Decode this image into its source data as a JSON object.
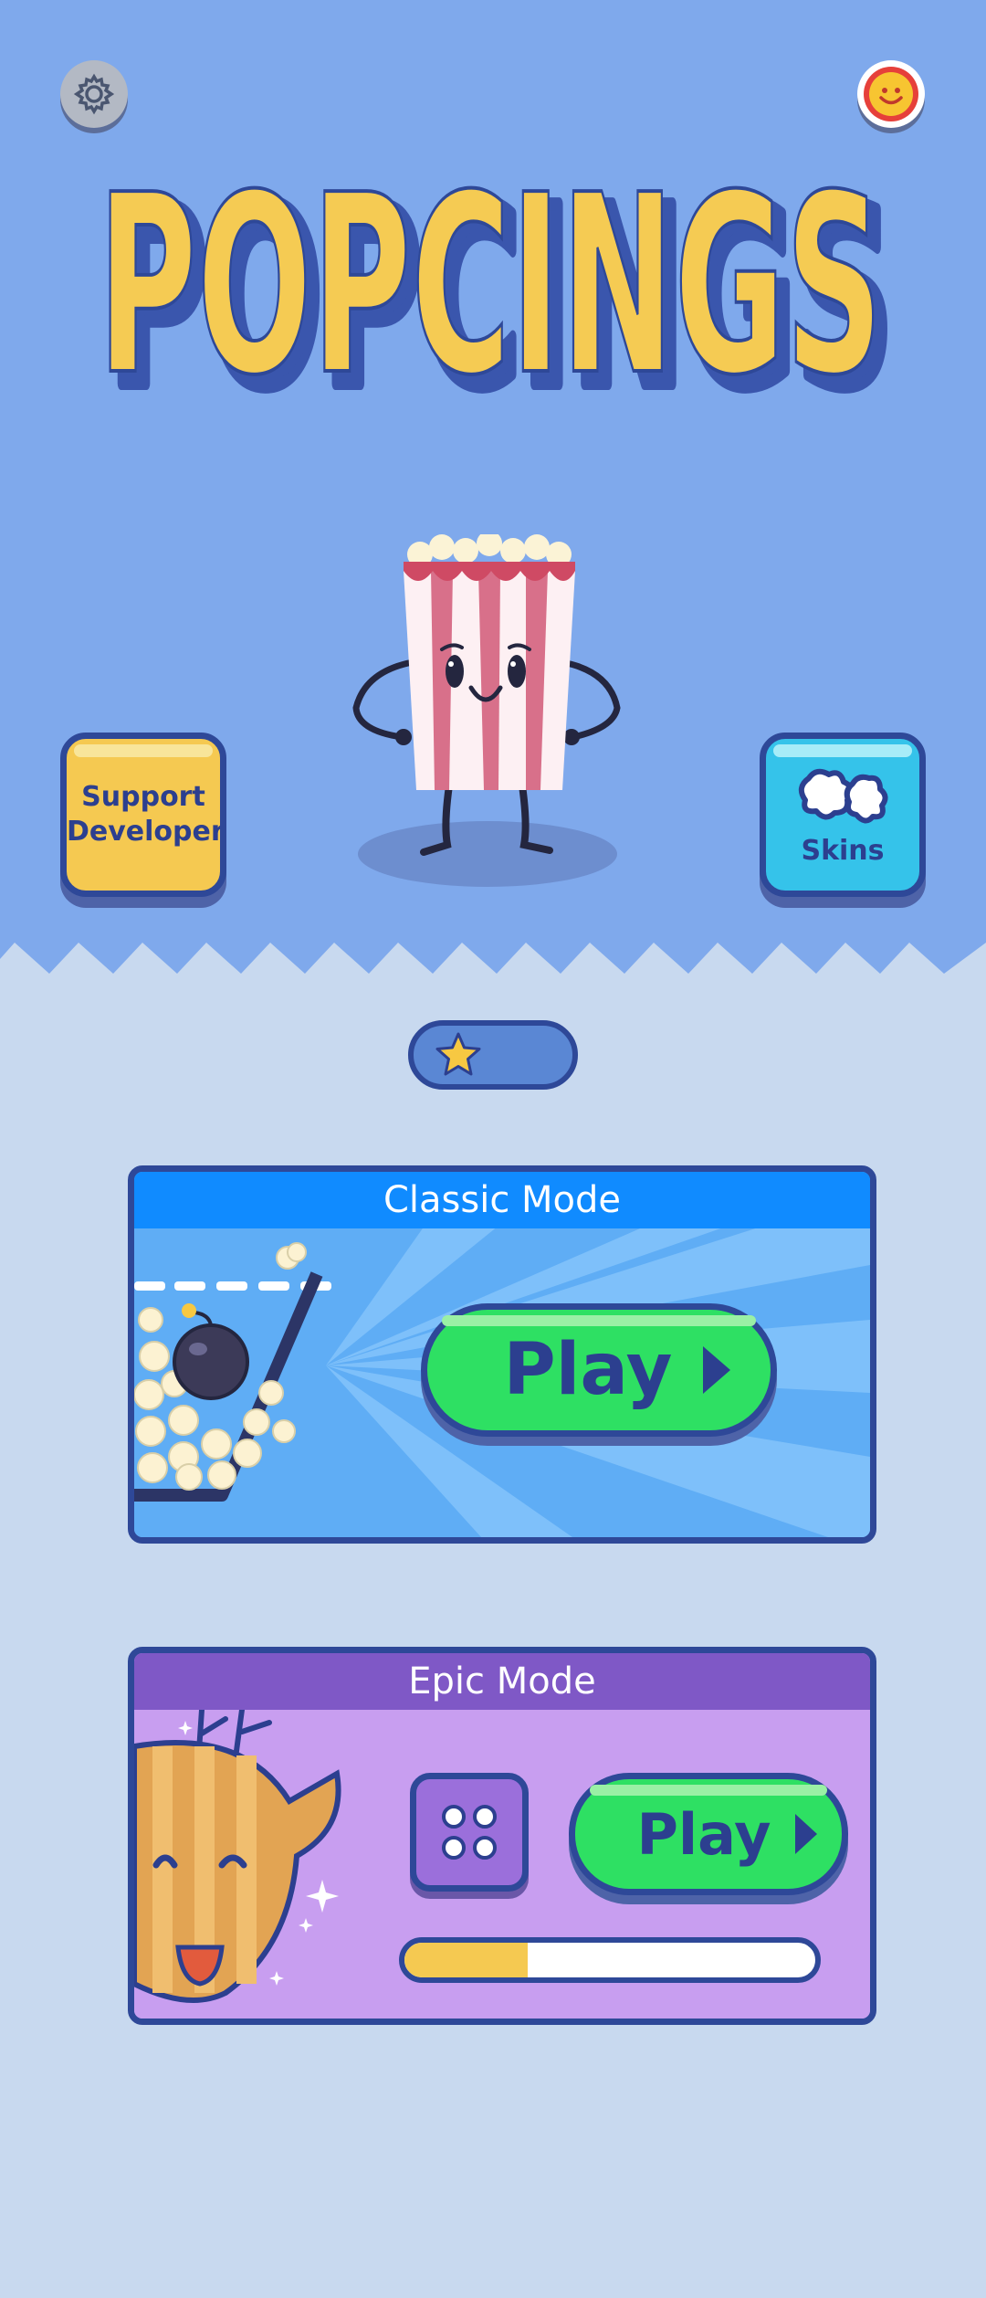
{
  "header": {
    "settings_icon": "gear-icon",
    "profile_icon": "smiley-face-icon",
    "title": "POPCINGS"
  },
  "buttons": {
    "support_label": "Support Developers",
    "skins_label": "Skins",
    "skins_icon": "popcorn-kernels-icon"
  },
  "stars": {
    "icon": "star-icon",
    "count": ""
  },
  "modes": {
    "classic": {
      "title": "Classic Mode",
      "play_label": "Play"
    },
    "epic": {
      "title": "Epic Mode",
      "play_label": "Play",
      "dice_icon": "dice-icon",
      "progress": 0.3
    }
  },
  "colors": {
    "sky": "#7fa9ec",
    "ground": "#c8d9ef",
    "title_fill": "#f5cb53",
    "title_shadow": "#3a56ad",
    "outline": "#2e4898",
    "play_green": "#2ee063",
    "classic_header": "#108bff",
    "epic_header": "#7f58c6",
    "progress_fill": "#f5c951"
  }
}
